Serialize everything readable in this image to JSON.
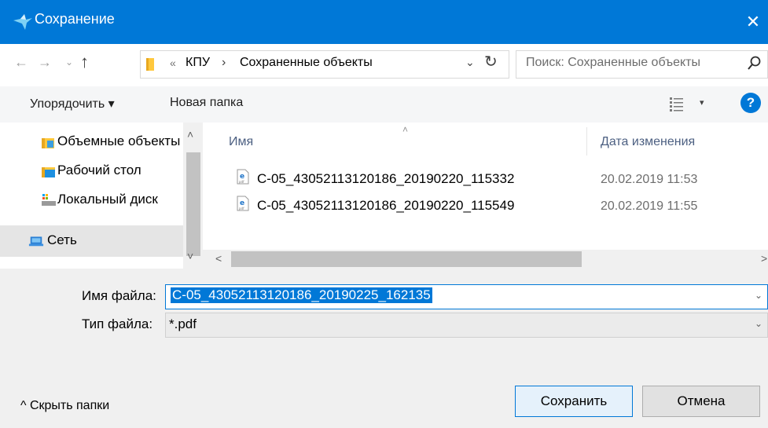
{
  "window": {
    "title": "Сохранение",
    "close_glyph": "✕",
    "title_icon": "bird-icon",
    "accent_color": "#0078d7"
  },
  "nav": {
    "back_glyph": "←",
    "forward_glyph": "→",
    "recent_glyph": "⌄",
    "up_glyph": "↑",
    "refresh_glyph": "↻"
  },
  "address": {
    "overflow": "«",
    "parent": "КПУ",
    "separator": "›",
    "current": "Сохраненные объекты",
    "dropdown_glyph": "⌄"
  },
  "search": {
    "placeholder": "Поиск: Сохраненные объекты"
  },
  "toolbar": {
    "organize_label": "Упорядочить ▾",
    "new_folder_label": "Новая папка",
    "view_dropdown_glyph": "▾",
    "help_label": "?"
  },
  "sidebar": {
    "items": [
      {
        "label": "Объемные объекты",
        "icon": "3d-objects-folder-icon"
      },
      {
        "label": "Рабочий стол",
        "icon": "desktop-folder-icon"
      },
      {
        "label": "Локальный диск",
        "icon": "local-disk-icon"
      },
      {
        "label": "Сеть",
        "icon": "network-icon",
        "selected": true
      }
    ],
    "scroll_up": "˄",
    "scroll_down": "˅"
  },
  "filelist": {
    "sort_caret": "˄",
    "columns": {
      "name": "Имя",
      "date": "Дата изменения"
    },
    "files": [
      {
        "name": "C-05_43052113120186_20190220_115332",
        "date": "20.02.2019 11:53",
        "icon": "pdf-file-icon"
      },
      {
        "name": "C-05_43052113120186_20190220_115549",
        "date": "20.02.2019 11:55",
        "icon": "pdf-file-icon"
      }
    ],
    "scroll_left": "<",
    "scroll_right": ">"
  },
  "form": {
    "filename_label": "Имя файла:",
    "filename_value": "C-05_43052113120186_20190225_162135",
    "filetype_label": "Тип файла:",
    "filetype_value": "*.pdf",
    "dropdown_glyph": "⌄"
  },
  "footer": {
    "hide_folders_label": "^ Скрыть папки",
    "save_label": "Сохранить",
    "cancel_label": "Отмена"
  }
}
